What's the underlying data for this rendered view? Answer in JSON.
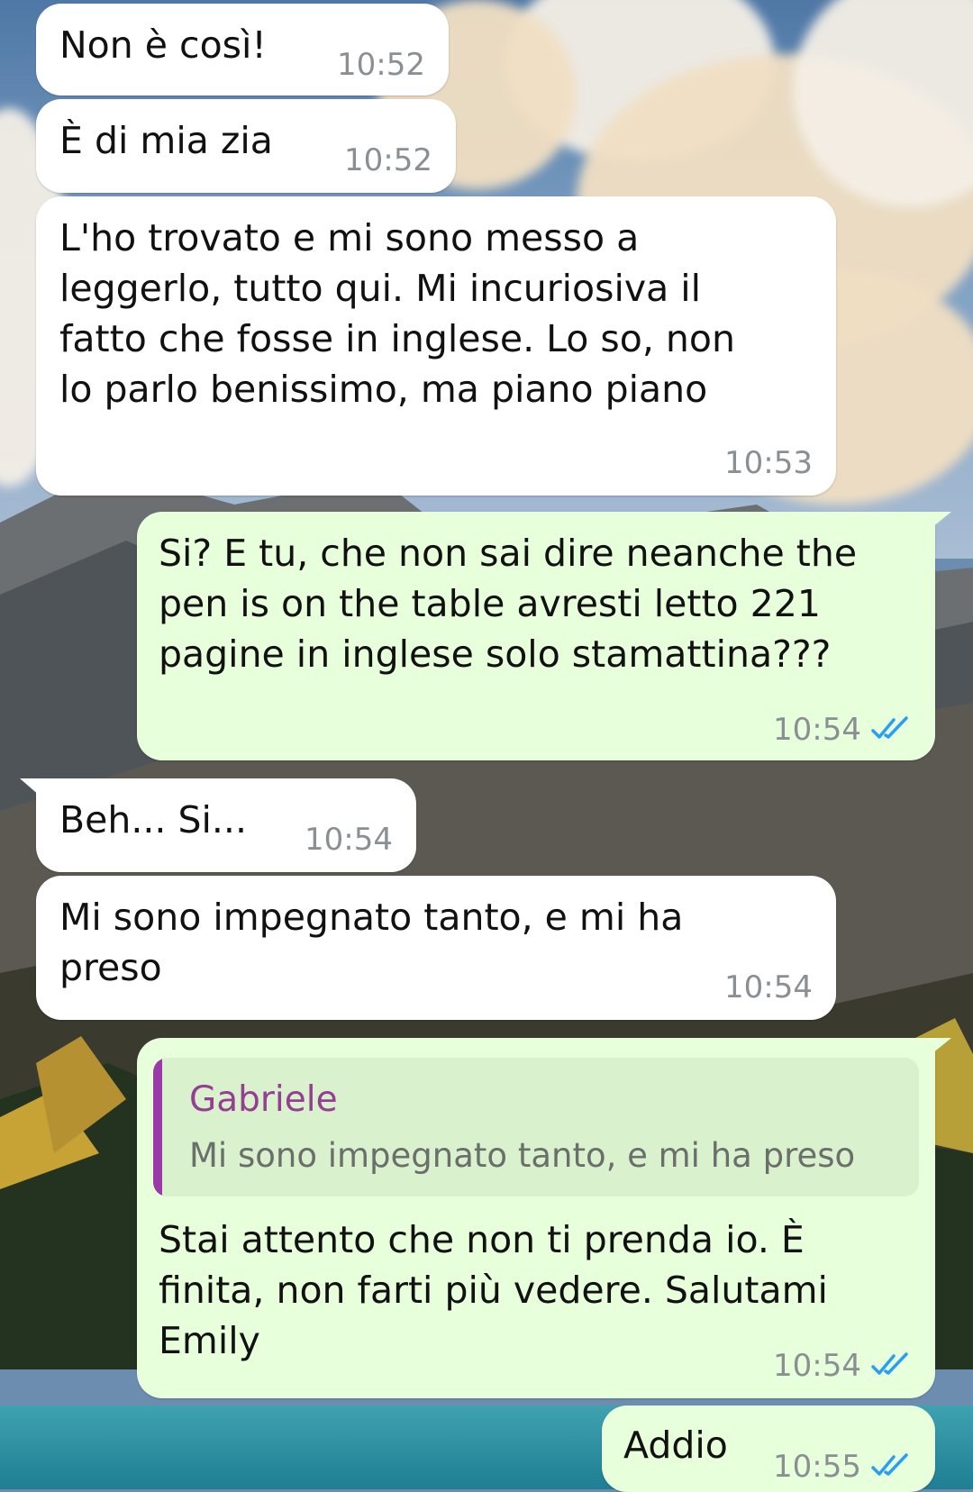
{
  "messages": [
    {
      "direction": "in",
      "text": "Non è così!",
      "time": "10:52"
    },
    {
      "direction": "in",
      "text": "È di mia zia",
      "time": "10:52"
    },
    {
      "direction": "in",
      "text": "L'ho trovato e mi sono messo a\nleggerlo, tutto qui. Mi incuriosiva il\nfatto che fosse in inglese. Lo so, non\nlo parlo benissimo, ma piano piano",
      "time": "10:53"
    },
    {
      "direction": "out",
      "text": "Si? E tu, che non sai dire neanche the\npen is on the table avresti letto 221\npagine in inglese solo stamattina???",
      "time": "10:54",
      "status": "read"
    },
    {
      "direction": "in",
      "text": "Beh... Si...",
      "time": "10:54"
    },
    {
      "direction": "in",
      "text": "Mi sono impegnato tanto, e mi ha\npreso",
      "time": "10:54"
    },
    {
      "direction": "out",
      "reply": {
        "name": "Gabriele",
        "text": "Mi sono impegnato tanto, e mi ha preso"
      },
      "text": "Stai attento che non ti prenda io. È\nfinita, non farti più vedere. Salutami\nEmily",
      "time": "10:54",
      "status": "read"
    },
    {
      "direction": "out",
      "text": "Addio",
      "time": "10:55",
      "status": "read"
    }
  ],
  "colors": {
    "incoming_bubble": "#ffffff",
    "outgoing_bubble": "#e7ffdb",
    "read_ticks": "#2a9ef0",
    "reply_accent": "#9a3aa6",
    "timestamp": "#8a8f93"
  },
  "icons": {
    "read_receipt": "double-check-icon"
  }
}
